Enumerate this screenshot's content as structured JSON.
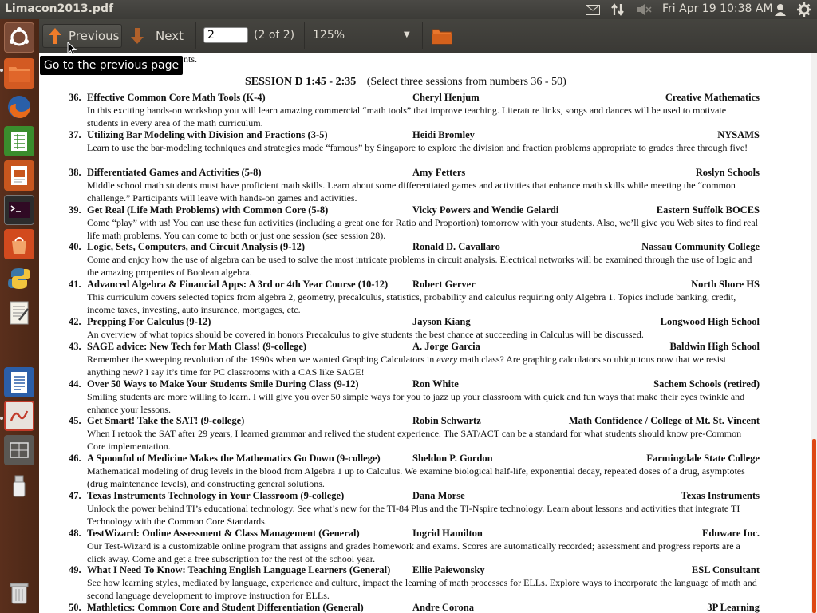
{
  "window": {
    "title": "Limacon2013.pdf"
  },
  "panel": {
    "clock": "Fri Apr 19 10:38 AM"
  },
  "toolbar": {
    "previous_label": "Previous",
    "next_label": "Next",
    "page_value": "2",
    "page_count": "(2 of 2)",
    "zoom": "125%",
    "tooltip": "Go to the previous page"
  },
  "document": {
    "clipped_top_line": "nts.",
    "session_heading": "SESSION D 1:45 - 2:35",
    "session_note": "(Select three sessions from numbers 36 - 50)",
    "entries": [
      {
        "num": "36.",
        "title": "Effective Common Core Math Tools (K-4)",
        "presenter": "Cheryl Henjum",
        "org": "Creative Mathematics",
        "desc": "In this exciting hands-on workshop you will learn amazing commercial “math tools” that improve teaching. Literature links, songs and dances will be used to motivate students in every area of the math curriculum."
      },
      {
        "num": "37.",
        "title": "Utilizing Bar Modeling with Division and Fractions (3-5)",
        "presenter": "Heidi Bromley",
        "org": "NYSAMS",
        "desc": "Learn to use the bar-modeling techniques and strategies made “famous” by Singapore to explore the division and fraction problems appropriate to grades three through five!"
      },
      {
        "num": "38.",
        "title": "Differentiated Games and Activities (5-8)",
        "presenter": "Amy Fetters",
        "org": "Roslyn Schools",
        "desc": "Middle school math students must have proficient math skills. Learn about some differentiated games and activities that enhance math skills while meeting the “common challenge.” Participants will leave with hands-on games and activities."
      },
      {
        "num": "39.",
        "title": "Get Real (Life Math Problems) with Common Core (5-8)",
        "presenter": "Vicky Powers and Wendie Gelardi",
        "org": "Eastern Suffolk BOCES",
        "desc": "Come “play” with us! You can use these fun activities (including a great one for Ratio and Proportion) tomorrow with your students. Also, we’ll give you Web sites to find real life math problems. You can come to both or just one session (see session 28)."
      },
      {
        "num": "40.",
        "title": "Logic, Sets, Computers, and Circuit Analysis (9-12)",
        "presenter": "Ronald D. Cavallaro",
        "org": "Nassau Community College",
        "desc": "Come and enjoy how the use of algebra can be used to solve the most intricate problems in circuit analysis. Electrical networks will be examined through the use of logic and the amazing properties of Boolean algebra."
      },
      {
        "num": "41.",
        "title": "Advanced Algebra & Financial Apps: A 3rd or 4th Year Course (10-12)",
        "presenter": "Robert Gerver",
        "org": "North Shore HS",
        "desc": "This curriculum covers selected topics from algebra 2, geometry, precalculus, statistics, probability and calculus requiring only Algebra 1. Topics include banking, credit, income taxes, investing, auto insurance, mortgages, etc."
      },
      {
        "num": "42.",
        "title": "Prepping For Calculus (9-12)",
        "presenter": "Jayson Kiang",
        "org": "Longwood High School",
        "desc": "An overview of what topics should be covered in honors Precalculus to give students the best chance at succeeding in Calculus will be discussed."
      },
      {
        "num": "43.",
        "title": "SAGE advice: New Tech for Math Class! (9-college)",
        "presenter": "A. Jorge Garcia",
        "org": "Baldwin High School",
        "desc": "Remember the sweeping revolution of the 1990s when we wanted Graphing Calculators in every math class? Are graphing calculators so ubiquitous now that we resist anything new? I say it’s time for PC classrooms with a CAS like SAGE!"
      },
      {
        "num": "44.",
        "title": "Over 50 Ways to Make Your Students Smile During Class (9-12)",
        "presenter": "Ron White",
        "org": "Sachem Schools (retired)",
        "desc": "Smiling students are more willing to learn. I will give you over 50 simple ways for you to jazz up your classroom with quick and fun ways that make their eyes twinkle and enhance your lessons."
      },
      {
        "num": "45.",
        "title": "Get Smart! Take the SAT! (9-college)",
        "presenter": "Robin Schwartz",
        "org": "Math Confidence / College of Mt. St. Vincent",
        "desc": "When I retook the SAT after 29 years, I learned grammar and relived the student experience. The SAT/ACT can be a standard for what students should know pre-Common Core implementation."
      },
      {
        "num": "46.",
        "title": "A Spoonful of Medicine Makes the Mathematics Go Down (9-college)",
        "presenter": "Sheldon P. Gordon",
        "org": "Farmingdale State College",
        "desc": "Mathematical modeling of drug levels in the blood from Algebra 1 up to Calculus. We examine biological half-life, exponential decay, repeated doses of a drug, asymptotes (drug maintenance levels), and constructing general solutions."
      },
      {
        "num": "47.",
        "title": "Texas Instruments Technology in Your Classroom (9-college)",
        "presenter": "Dana Morse",
        "org": "Texas Instruments",
        "desc": "Unlock the power behind TI’s educational technology. See what’s new for the TI-84 Plus and the TI-Nspire technology. Learn about lessons and activities that integrate TI Technology with the Common Core Standards."
      },
      {
        "num": "48.",
        "title": "TestWizard: Online Assessment & Class Management (General)",
        "presenter": "Ingrid Hamilton",
        "org": "Eduware Inc.",
        "desc": "Our Test-Wizard is a customizable online program that assigns and grades homework and exams. Scores are automatically recorded; assessment and progress reports are a click away. Come and get a free subscription for the rest of the school year."
      },
      {
        "num": "49.",
        "title": "What I Need To Know: Teaching English Language Learners (General)",
        "presenter": "Ellie Paiewonsky",
        "org": "ESL Consultant",
        "desc": "See how learning styles, mediated by language, experience and culture, impact the learning of math processes for ELLs. Explore ways to incorporate the language of math and second language development to improve instruction for ELLs."
      },
      {
        "num": "50.",
        "title": "Mathletics: Common Core and Student Differentiation (General)",
        "presenter": "Andre Corona",
        "org": "3P Learning",
        "desc": ""
      }
    ]
  },
  "scroll": {
    "position_fraction": 0.69,
    "visible_fraction": 0.31
  },
  "colors": {
    "accent": "#dd4814",
    "launcher_bg": "#5a2f1c",
    "toolbar_bg": "#3c3b37"
  }
}
